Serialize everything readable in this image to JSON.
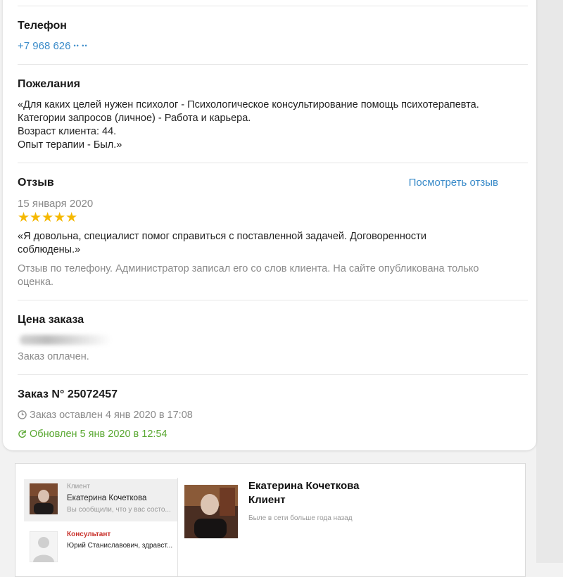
{
  "phone": {
    "heading": "Телефон",
    "number": "+7 968 626",
    "masked": "•• ••"
  },
  "wishes": {
    "heading": "Пожелания",
    "lines": [
      "«Для каких целей нужен психолог - Психологическое консультирование помощь психотерапевта.",
      "Категории запросов (личное) - Работа и карьера.",
      "Возраст клиента: 44.",
      "Опыт терапии - Был.»"
    ]
  },
  "review": {
    "heading": "Отзыв",
    "view_link": "Посмотреть отзыв",
    "date": "15 января 2020",
    "rating": 5,
    "stars": "★★★★★",
    "text_lines": [
      "«Я довольна, специалист помог справиться с поставленной задачей. Договоренности",
      "соблюдены.»"
    ],
    "note_lines": [
      "Отзыв по телефону. Администратор записал его со слов клиента. На сайте опубликована только",
      "оценка."
    ]
  },
  "price": {
    "heading": "Цена заказа",
    "status": "Заказ оплачен."
  },
  "order": {
    "heading": "Заказ N° 25072457",
    "created": "Заказ оставлен 4 янв 2020 в 17:08",
    "updated": "Обновлен 5 янв 2020 в 12:54",
    "updated_color": "#5aa832"
  },
  "chat": {
    "conversations": [
      {
        "role": "Клиент",
        "name": "Екатерина Кочеткова",
        "preview": "Вы сообщили, что у вас состо..."
      },
      {
        "role": "Консультант",
        "name": "Юрий Станиславович, здравст...",
        "preview": ""
      }
    ],
    "contact": {
      "name": "Екатерина Кочеткова",
      "role": "Клиент",
      "status": "Быле в сети больше года назад"
    }
  },
  "colors": {
    "link": "#3a8bc9",
    "star": "#f5b800",
    "success": "#5aa832",
    "consultant_role": "#c8312b"
  }
}
